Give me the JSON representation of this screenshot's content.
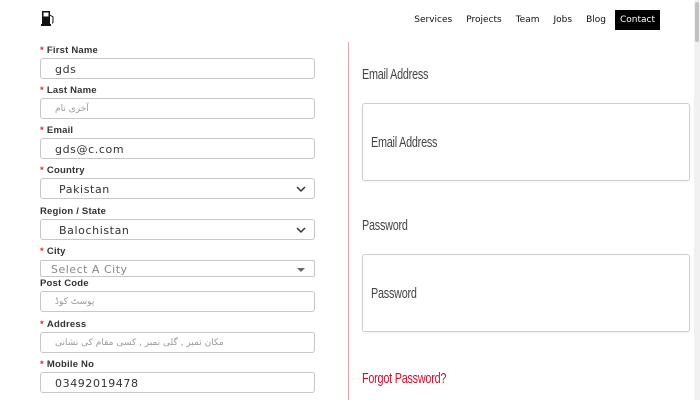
{
  "nav": {
    "items": [
      {
        "label": "Services"
      },
      {
        "label": "Projects"
      },
      {
        "label": "Team"
      },
      {
        "label": "Jobs"
      },
      {
        "label": "Blog"
      },
      {
        "label": "Contact",
        "active": true
      }
    ]
  },
  "colors": {
    "required_marker": "#d9302c",
    "link": "#c8102e",
    "divider": "#e3a9a9",
    "active_nav_bg": "#000000"
  },
  "form": {
    "first_name": {
      "label": "First Name",
      "required": true,
      "value": "gds"
    },
    "last_name": {
      "label": "Last Name",
      "required": true,
      "placeholder": "آخری نام"
    },
    "email": {
      "label": "Email",
      "required": true,
      "value": "gds@c.com"
    },
    "country": {
      "label": "Country",
      "required": true,
      "value": "Pakistan"
    },
    "region": {
      "label": "Region / State",
      "required": false,
      "value": "Balochistan"
    },
    "city": {
      "label": "City",
      "required": true,
      "value": "Select A City"
    },
    "post_code": {
      "label": "Post Code",
      "required": false,
      "placeholder": "پوسٹ کوڈ"
    },
    "address": {
      "label": "Address",
      "required": true,
      "placeholder": "مکان نمبر , گلی نمبر , کسی مقام کی نشانی"
    },
    "mobile": {
      "label": "Mobile No",
      "required": true,
      "value": "03492019478"
    }
  },
  "login": {
    "email_label": "Email Address",
    "email_placeholder": "Email Address",
    "password_label": "Password",
    "password_placeholder": "Password",
    "forgot_link": "Forgot Password?"
  }
}
